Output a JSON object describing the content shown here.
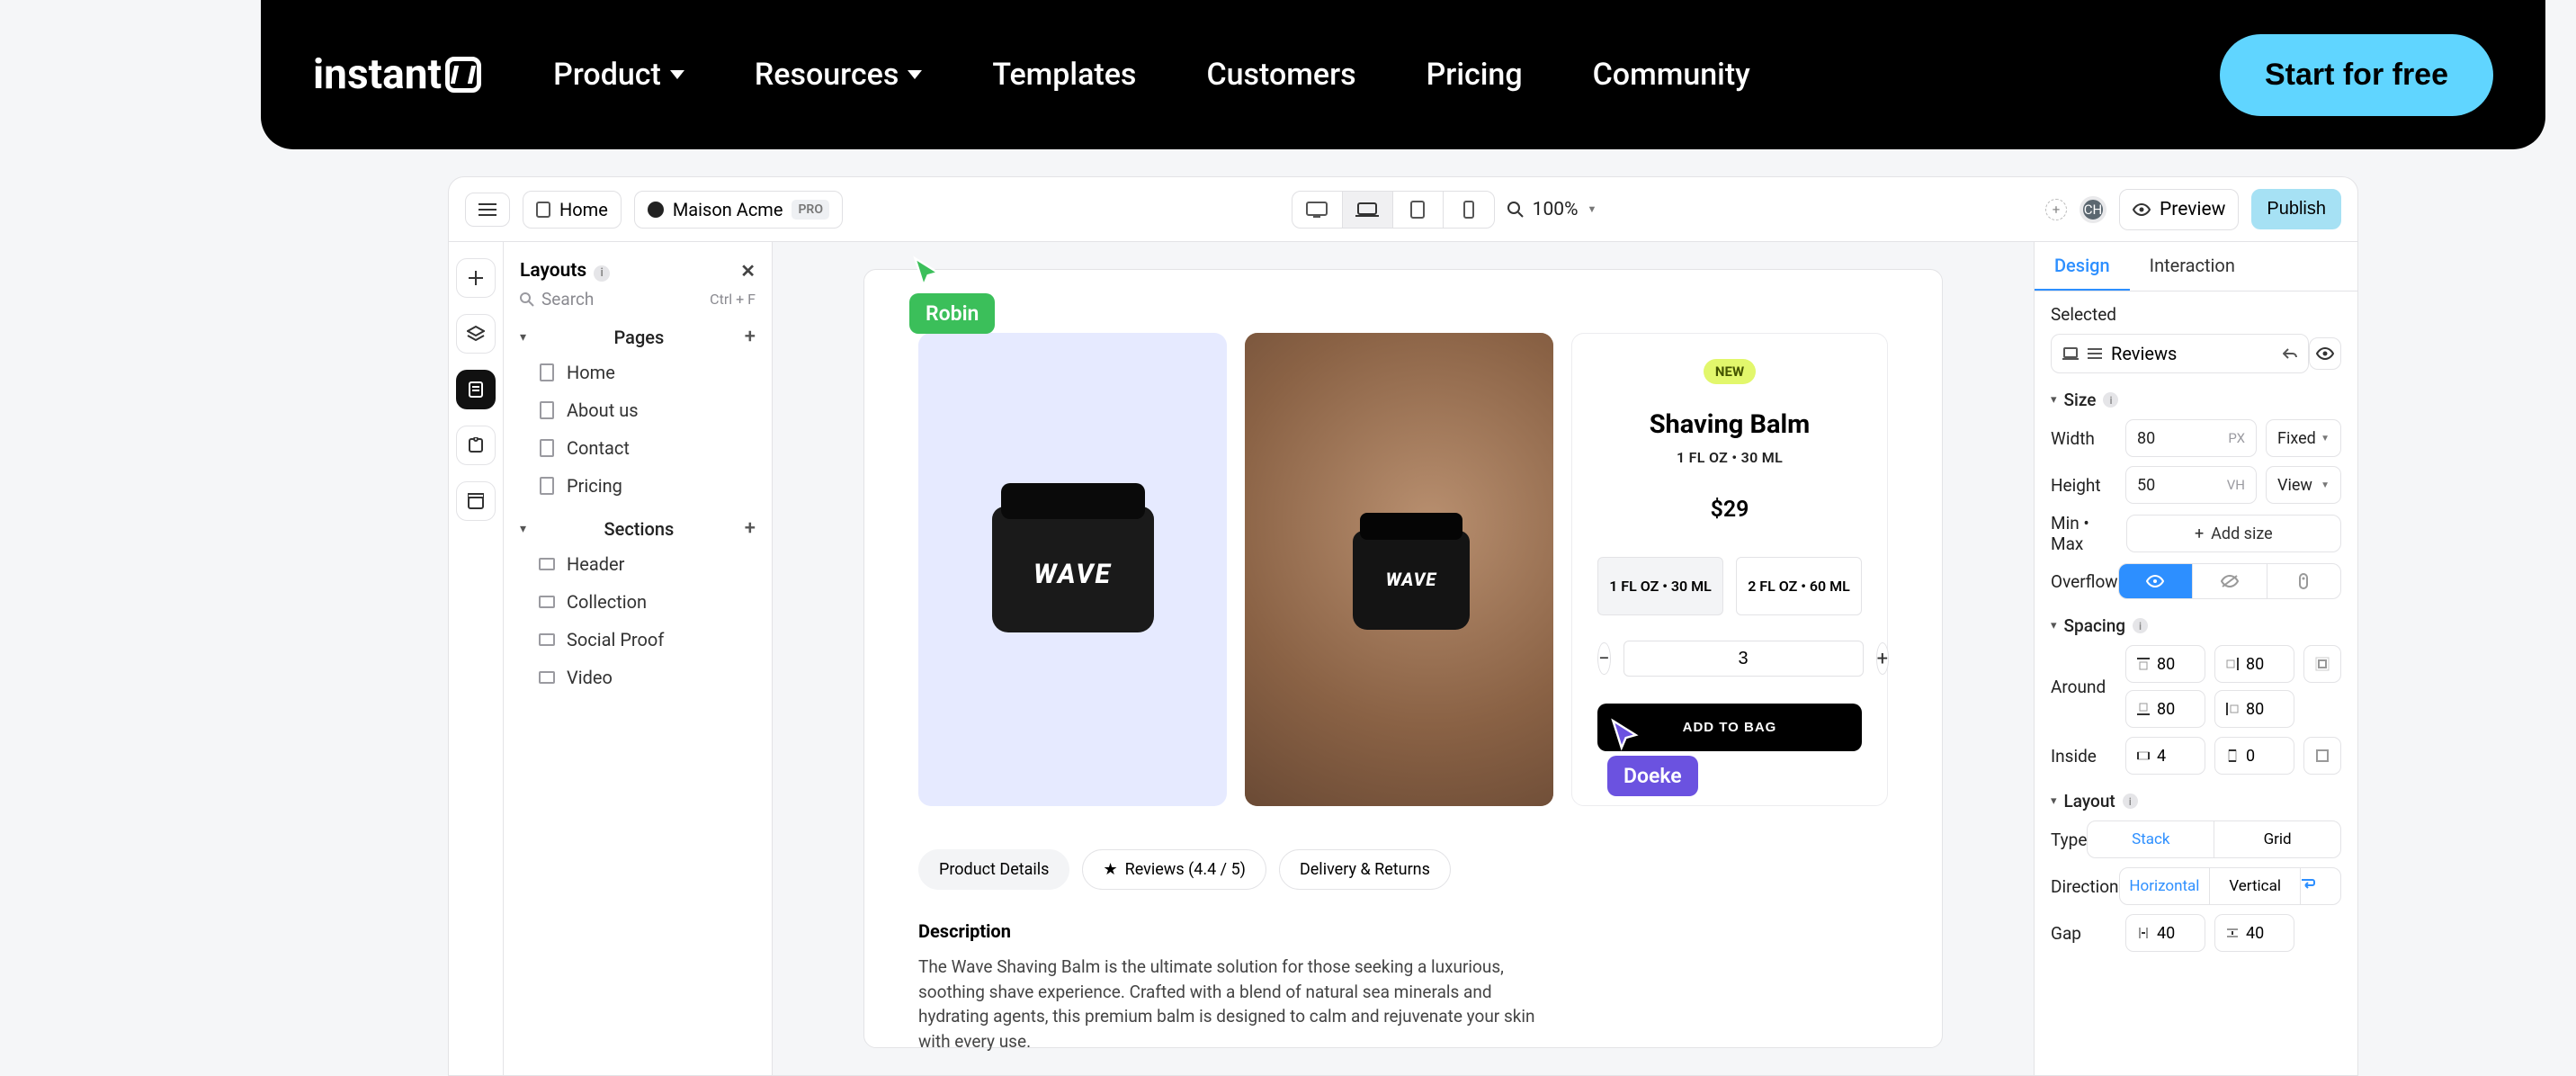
{
  "nav": {
    "brand": "instant",
    "links": [
      "Product",
      "Resources",
      "Templates",
      "Customers",
      "Pricing",
      "Community"
    ],
    "cta": "Start for free"
  },
  "toolbar": {
    "home": "Home",
    "org": "Maison Acme",
    "org_badge": "PRO",
    "zoom": "100%",
    "preview": "Preview",
    "publish": "Publish",
    "avatar": "CH"
  },
  "sidebar": {
    "layouts": "Layouts",
    "search_placeholder": "Search",
    "search_kbd": "Ctrl + F",
    "pages_head": "Pages",
    "pages": [
      "Home",
      "About us",
      "Contact",
      "Pricing"
    ],
    "sections_head": "Sections",
    "sections": [
      "Header",
      "Collection",
      "Social Proof",
      "Video"
    ]
  },
  "cursors": {
    "robin": "Robin",
    "doeke": "Doeke"
  },
  "product": {
    "brand": "WAVE",
    "new": "NEW",
    "title": "Shaving Balm",
    "subtitle": "1 FL OZ • 30 ML",
    "price": "$29",
    "options": [
      "1 FL OZ • 30 ML",
      "2 FL OZ • 60 ML"
    ],
    "qty": "3",
    "buy": "ADD TO BAG",
    "tabs": [
      "Product Details",
      "Reviews (4.4 / 5)",
      "Delivery & Returns"
    ],
    "desc_head": "Description",
    "desc": "The Wave Shaving Balm is the ultimate solution for those seeking a luxurious, soothing shave experience. Crafted with a blend of natural sea minerals and hydrating agents, this premium balm is designed to calm and rejuvenate your skin with every use."
  },
  "props": {
    "tabs": [
      "Design",
      "Interaction"
    ],
    "selected_label": "Selected",
    "selected_name": "Reviews",
    "size_head": "Size",
    "width": "Width",
    "width_val": "80",
    "width_unit": "PX",
    "width_mode": "Fixed",
    "height": "Height",
    "height_val": "50",
    "height_unit": "VH",
    "height_mode": "View",
    "minmax": "Min • Max",
    "addsize": "Add size",
    "overflow": "Overflow",
    "spacing_head": "Spacing",
    "around": "Around",
    "around_vals": [
      "80",
      "80",
      "80",
      "80"
    ],
    "inside": "Inside",
    "inside_vals": [
      "4",
      "0"
    ],
    "layout_head": "Layout",
    "type": "Type",
    "type_opts": [
      "Stack",
      "Grid"
    ],
    "direction": "Direction",
    "dir_opts": [
      "Horizontal",
      "Vertical"
    ],
    "gap": "Gap",
    "gap_vals": [
      "40",
      "40"
    ]
  }
}
